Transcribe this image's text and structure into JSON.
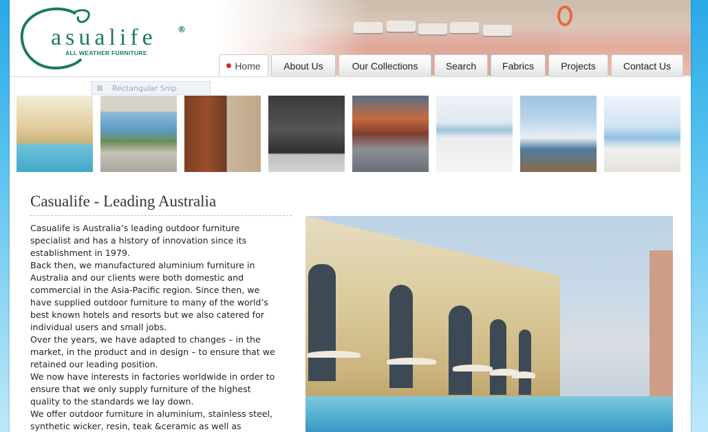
{
  "brand": {
    "name": "asualife",
    "reg": "®",
    "tagline": "ALL WEATHER FURNITURE",
    "colors": {
      "brand": "#1a7a62",
      "accent": "#d8262a"
    }
  },
  "nav": {
    "tabs": [
      {
        "label": "Home",
        "active": true
      },
      {
        "label": "About Us"
      },
      {
        "label": "Our Collections"
      },
      {
        "label": "Search"
      },
      {
        "label": "Fabrics"
      },
      {
        "label": "Projects"
      },
      {
        "label": "Contact Us"
      }
    ]
  },
  "overlay": {
    "ghost_label": "Rectangular Snip"
  },
  "gallery": {
    "thumbnails": [
      "hotel-pool-thumb",
      "modern-table-thumb",
      "rust-chair-thumb",
      "stone-wall-thumb",
      "firepit-lounge-thumb",
      "sea-view-sofa-thumb",
      "cabana-deck-thumb",
      "ocean-lounge-thumb"
    ]
  },
  "main": {
    "title": "Casualife - Leading Australia",
    "paragraphs": [
      "Casualife is Australia’s leading outdoor furniture specialist and has a history of innovation since its establishment in 1979.",
      "Back then, we manufactured aluminium furniture in Australia and our clients were both domestic and commercial in the Asia-Pacific region. Since then, we have supplied outdoor furniture to many of the world’s best known hotels and resorts but we also catered for individual users and small jobs.",
      "Over the years, we have adapted to changes – in the market, in the product and in design – to ensure that we retained our leading position.",
      "We now have interests in factories worldwide in order to ensure that we only supply furniture of the highest quality to the standards we lay down.",
      "We offer outdoor furniture in aluminium, stainless steel, synthetic wicker, resin, teak  &ceramic as well as"
    ]
  }
}
